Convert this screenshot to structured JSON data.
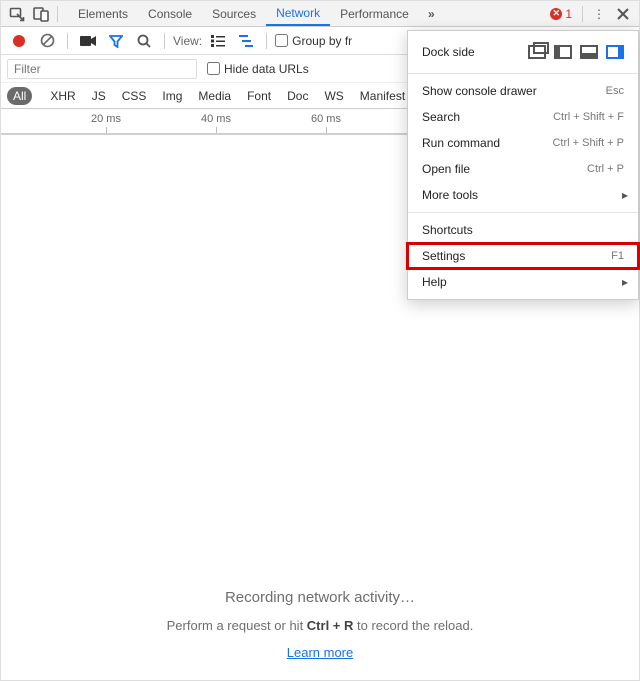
{
  "tabs": [
    "Elements",
    "Console",
    "Sources",
    "Network",
    "Performance"
  ],
  "active_tab": "Network",
  "error_count": "1",
  "toolbar": {
    "view_label": "View:",
    "group_label": "Group by fr"
  },
  "filter": {
    "placeholder": "Filter",
    "hide_label": "Hide data URLs"
  },
  "types": [
    "All",
    "XHR",
    "JS",
    "CSS",
    "Img",
    "Media",
    "Font",
    "Doc",
    "WS",
    "Manifest"
  ],
  "active_type": "All",
  "timeline_ticks": [
    "20 ms",
    "40 ms",
    "60 ms"
  ],
  "empty": {
    "title": "Recording network activity…",
    "sub_pre": "Perform a request or hit ",
    "sub_bold": "Ctrl + R",
    "sub_post": " to record the reload.",
    "learn": "Learn more"
  },
  "menu": {
    "dock_label": "Dock side",
    "items": [
      {
        "label": "Show console drawer",
        "shortcut": "Esc"
      },
      {
        "label": "Search",
        "shortcut": "Ctrl + Shift + F"
      },
      {
        "label": "Run command",
        "shortcut": "Ctrl + Shift + P"
      },
      {
        "label": "Open file",
        "shortcut": "Ctrl + P"
      },
      {
        "label": "More tools",
        "submenu": true
      }
    ],
    "items2": [
      {
        "label": "Shortcuts"
      },
      {
        "label": "Settings",
        "shortcut": "F1",
        "highlight": true
      },
      {
        "label": "Help",
        "submenu": true
      }
    ]
  }
}
